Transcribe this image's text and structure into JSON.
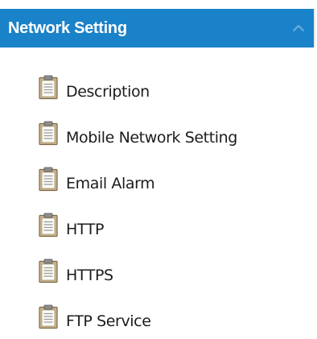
{
  "panel": {
    "title": "Network Setting",
    "collapse_icon": "chevron-up-icon",
    "header_color": "#1a82c8"
  },
  "menu": {
    "item_icon": "clipboard-icon",
    "items": [
      {
        "label": "Description"
      },
      {
        "label": "Mobile Network Setting"
      },
      {
        "label": "Email Alarm"
      },
      {
        "label": "HTTP"
      },
      {
        "label": "HTTPS"
      },
      {
        "label": "FTP Service"
      }
    ]
  }
}
